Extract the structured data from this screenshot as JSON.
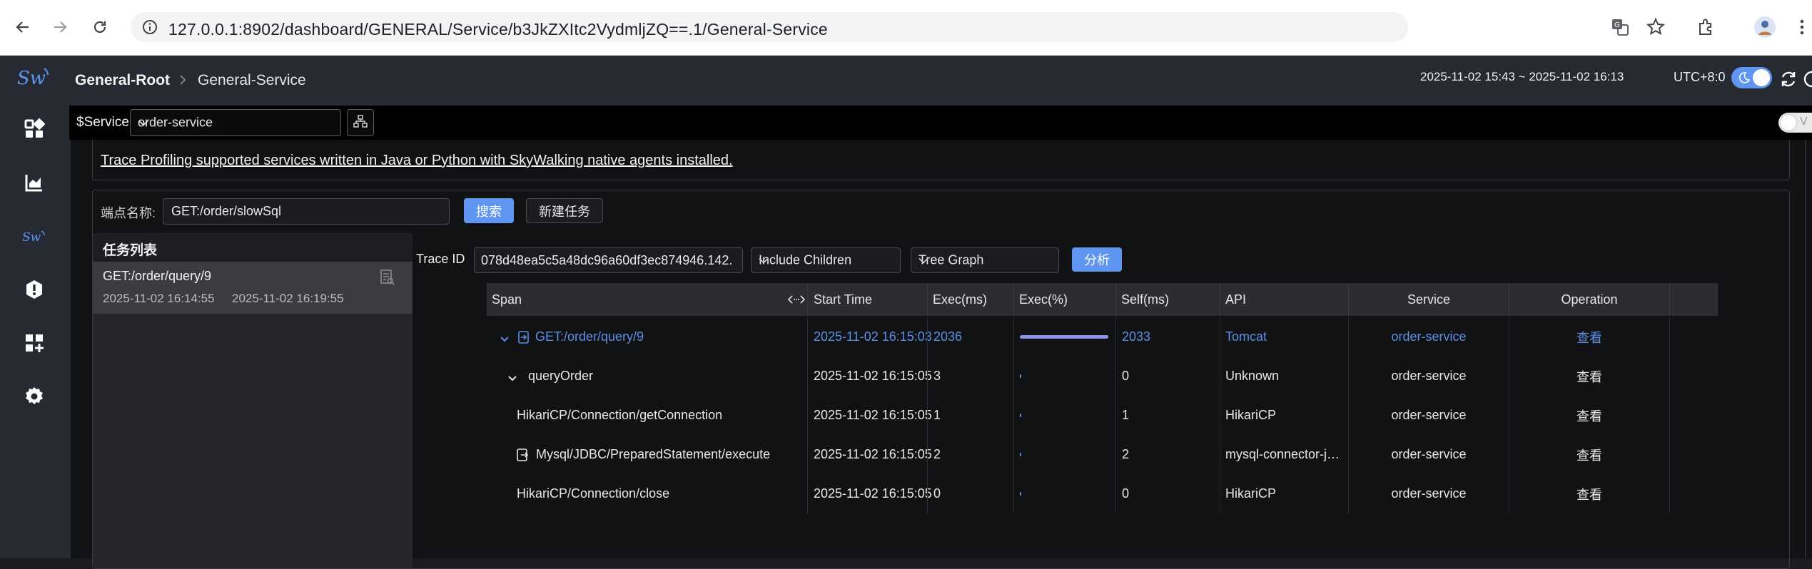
{
  "browser": {
    "url": "127.0.0.1:8902/dashboard/GENERAL/Service/b3JkZXItc2VydmljZQ==.1/General-Service"
  },
  "header": {
    "breadcrumb_root": "General-Root",
    "breadcrumb_current": "General-Service",
    "time_range": "2025-11-02 15:43 ~ 2025-11-02 16:13",
    "timezone": "UTC+8:0"
  },
  "toolbar": {
    "service_label": "$Service",
    "service_value": "order-service"
  },
  "notice": {
    "text": "Trace Profiling supported services written in Java or Python with SkyWalking native agents installed."
  },
  "search": {
    "endpoint_label": "端点名称:",
    "endpoint_value": "GET:/order/slowSql",
    "search_button": "搜索",
    "new_task_button": "新建任务"
  },
  "task_list": {
    "title": "任务列表",
    "items": [
      {
        "name": "GET:/order/query/9",
        "start": "2025-11-02 16:14:55",
        "end": "2025-11-02 16:19:55"
      }
    ]
  },
  "trace_controls": {
    "trace_id_label": "Trace ID",
    "trace_id_value": "078d48ea5c5a48dc96a60df3ec874946.142.",
    "mode_select": "Include Children",
    "graph_select": "Tree Graph",
    "analyze_button": "分析"
  },
  "table": {
    "headers": [
      "Span",
      "Start Time",
      "Exec(ms)",
      "Exec(%)",
      "Self(ms)",
      "API",
      "Service",
      "Operation"
    ],
    "rows": [
      {
        "span": "GET:/order/query/9",
        "start": "2025-11-02 16:15:03",
        "exec": "2036",
        "exec_pct": 1.0,
        "self": "2033",
        "api": "Tomcat",
        "service": "order-service",
        "op": "查看"
      },
      {
        "span": "queryOrder",
        "start": "2025-11-02 16:15:05",
        "exec": "3",
        "exec_pct": 0.0015,
        "self": "0",
        "api": "Unknown",
        "service": "order-service",
        "op": "查看"
      },
      {
        "span": "HikariCP/Connection/getConnection",
        "start": "2025-11-02 16:15:05",
        "exec": "1",
        "exec_pct": 0.0005,
        "self": "1",
        "api": "HikariCP",
        "service": "order-service",
        "op": "查看"
      },
      {
        "span": "Mysql/JDBC/PreparedStatement/execute",
        "start": "2025-11-02 16:15:05",
        "exec": "2",
        "exec_pct": 0.001,
        "self": "2",
        "api": "mysql-connector-j…",
        "service": "order-service",
        "op": "查看"
      },
      {
        "span": "HikariCP/Connection/close",
        "start": "2025-11-02 16:15:05",
        "exec": "0",
        "exec_pct": 0.0,
        "self": "0",
        "api": "HikariCP",
        "service": "order-service",
        "op": "查看"
      }
    ]
  },
  "colors": {
    "accent": "#5e96f2",
    "link": "#5a8fe6",
    "bar": "#7b7fd6"
  }
}
